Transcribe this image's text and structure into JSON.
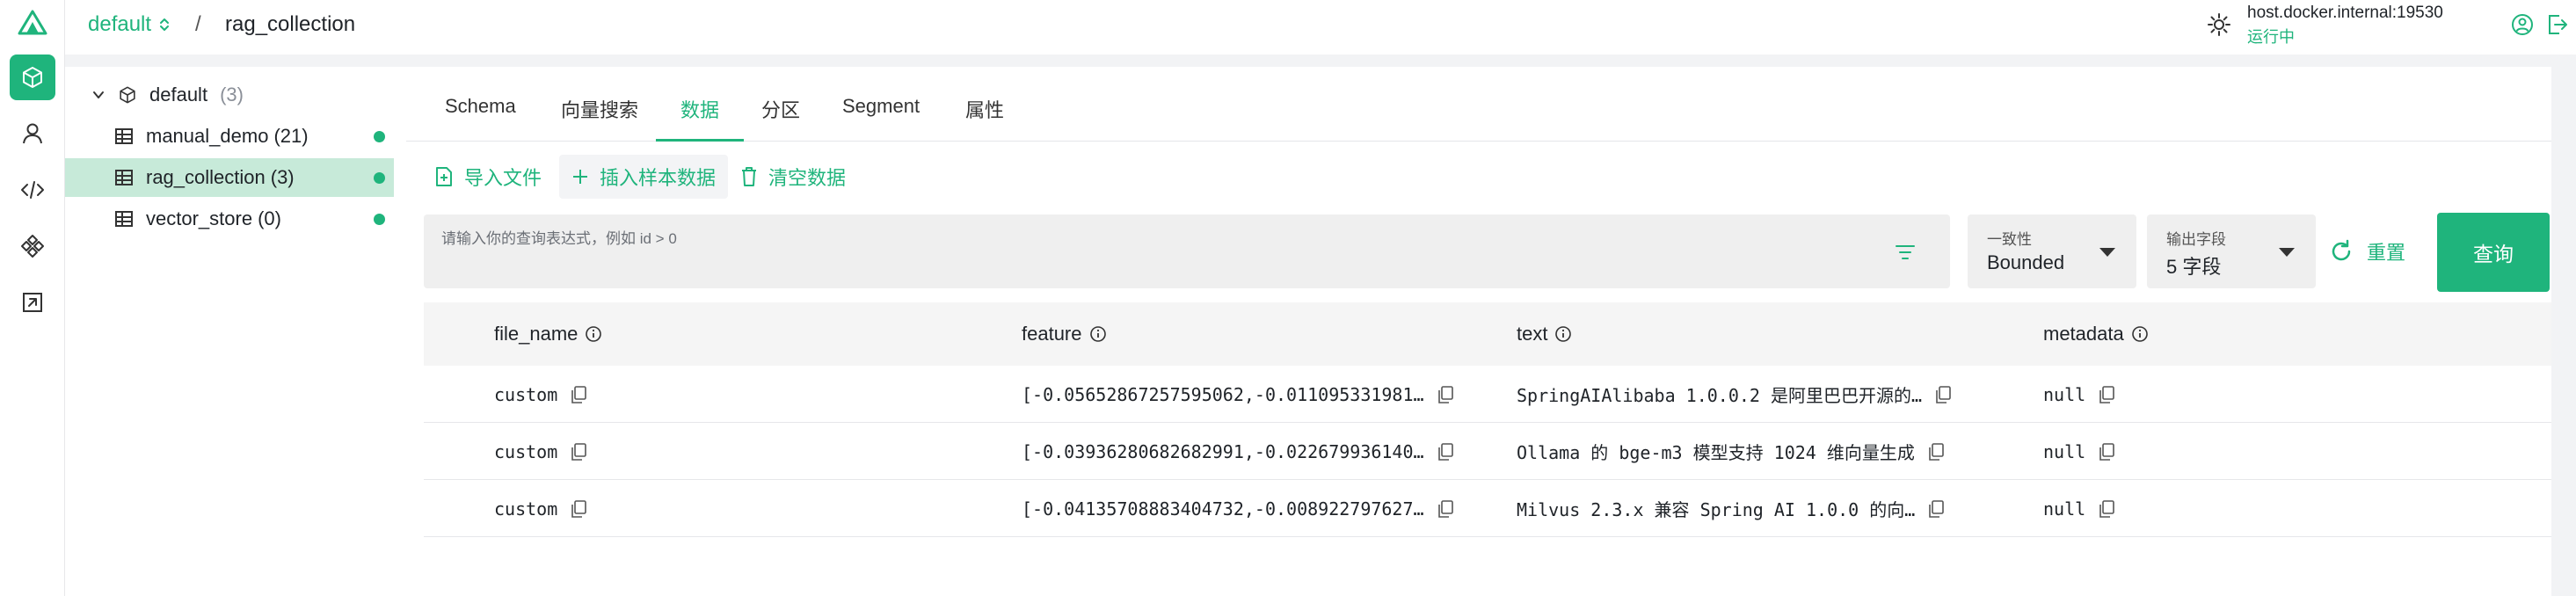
{
  "header": {
    "database": "default",
    "separator": "/",
    "collection": "rag_collection",
    "host": "host.docker.internal:19530",
    "status": "运行中"
  },
  "tree": {
    "root": {
      "label": "default",
      "count": "(3)"
    },
    "items": [
      {
        "label": "manual_demo",
        "count": "(21)"
      },
      {
        "label": "rag_collection",
        "count": "(3)"
      },
      {
        "label": "vector_store",
        "count": "(0)"
      }
    ]
  },
  "tabs": [
    "Schema",
    "向量搜索",
    "数据",
    "分区",
    "Segment",
    "属性"
  ],
  "actions": {
    "import": "导入文件",
    "insert_sample": "插入样本数据",
    "clear": "清空数据"
  },
  "query": {
    "placeholder": "请输入你的查询表达式，例如 id > 0",
    "consistency_label": "一致性",
    "consistency_value": "Bounded",
    "output_label": "输出字段",
    "output_value": "5 字段",
    "reset": "重置",
    "search": "查询"
  },
  "table": {
    "columns": [
      "file_name",
      "feature",
      "text",
      "metadata"
    ],
    "rows": [
      {
        "file_name": "custom",
        "feature": "[-0.05652867257595062,-0.011095331981…",
        "text": "SpringAIAlibaba 1.0.0.2 是阿里巴巴开源的…",
        "metadata": "null"
      },
      {
        "file_name": "custom",
        "feature": "[-0.03936280682682991,-0.022679936140…",
        "text": "Ollama 的 bge-m3 模型支持 1024 维向量生成",
        "metadata": "null"
      },
      {
        "file_name": "custom",
        "feature": "[-0.04135708883404732,-0.008922797627…",
        "text": "Milvus 2.3.x 兼容 Spring AI 1.0.0 的向…",
        "metadata": "null"
      }
    ]
  },
  "colors": {
    "accent": "#1fb47c",
    "selected_row": "#c7ead9",
    "page_bg": "#f2f3f5"
  }
}
